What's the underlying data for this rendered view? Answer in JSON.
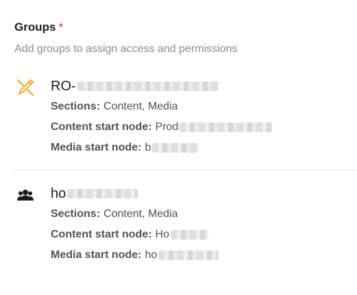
{
  "groups_field": {
    "label": "Groups",
    "required_marker": "*",
    "description": "Add groups to assign access and permissions"
  },
  "groups": [
    {
      "icon": "pencil-icon",
      "name_prefix": "RO-",
      "sections_label": "Sections:",
      "sections_value": "Content, Media",
      "content_start_label": "Content start node:",
      "content_start_prefix": "Prod",
      "media_start_label": "Media start node:",
      "media_start_prefix": "b"
    },
    {
      "icon": "users-icon",
      "name_prefix": "ho",
      "sections_label": "Sections:",
      "sections_value": "Content, Media",
      "content_start_label": "Content start node:",
      "content_start_prefix": "Ho",
      "media_start_label": "Media start node:",
      "media_start_prefix": "ho"
    }
  ],
  "colors": {
    "required": "#d42054",
    "pencil_icon": "#f5a623",
    "divider": "#e3e3e3"
  }
}
